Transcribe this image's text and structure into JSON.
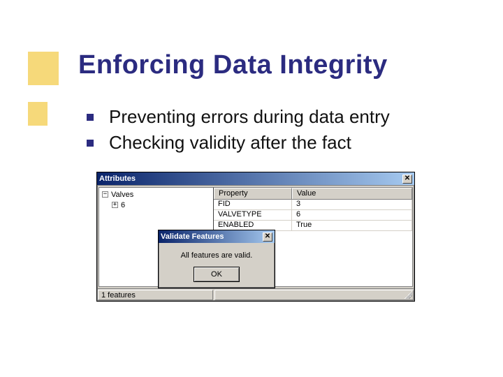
{
  "slide": {
    "title": "Enforcing Data Integrity",
    "bullets": [
      "Preventing errors during data entry",
      "Checking validity after the fact"
    ]
  },
  "attributes_window": {
    "title": "Attributes",
    "close_glyph": "✕",
    "tree": {
      "root_label": "Valves",
      "root_toggle": "−",
      "child_label": "6",
      "child_toggle": "+"
    },
    "grid": {
      "headers": {
        "property": "Property",
        "value": "Value"
      },
      "rows": [
        {
          "property": "FID",
          "value": "3"
        },
        {
          "property": "VALVETYPE",
          "value": "6"
        },
        {
          "property": "ENABLED",
          "value": "True"
        }
      ]
    },
    "status": "1 features"
  },
  "validate_dialog": {
    "title": "Validate Features",
    "close_glyph": "✕",
    "message": "All features are valid.",
    "ok_label": "OK"
  }
}
